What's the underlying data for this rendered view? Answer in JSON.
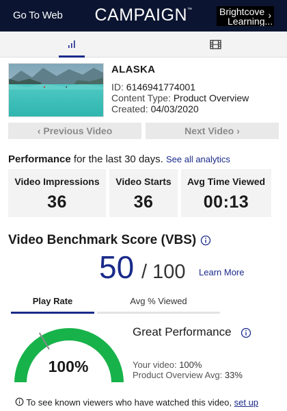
{
  "topbar": {
    "go_to_web": "Go To Web",
    "brand": "CAMPAIGN",
    "brand_tm": "™",
    "brightcove_line1": "Brightcove",
    "brightcove_line2": "Learning..."
  },
  "tabs": [
    {
      "icon": "bar-chart-icon",
      "active": true
    },
    {
      "icon": "film-icon",
      "active": false
    }
  ],
  "video": {
    "title": "ALASKA",
    "id_label": "ID:",
    "id_value": "6146941774001",
    "content_type_label": "Content Type:",
    "content_type_value": "Product Overview",
    "created_label": "Created:",
    "created_value": "04/03/2020"
  },
  "nav": {
    "prev": "Previous Video",
    "next": "Next Video"
  },
  "performance": {
    "label": "Performance",
    "period": "for the last 30 days.",
    "link": "See all analytics",
    "stats": [
      {
        "label": "Video Impressions",
        "value": "36"
      },
      {
        "label": "Video Starts",
        "value": "36"
      },
      {
        "label": "Avg Time Viewed",
        "value": "00:13"
      }
    ]
  },
  "vbs": {
    "title": "Video Benchmark Score (VBS)",
    "score": "50",
    "max": "/ 100",
    "learn_more": "Learn More",
    "tabs": [
      "Play Rate",
      "Avg % Viewed"
    ],
    "gauge_value": "100%",
    "gauge_fraction": 1.0,
    "benchmark_fraction": 0.33,
    "status": "Great Performance",
    "your_video_label": "Your video:",
    "your_video_value": "100%",
    "avg_label": "Product Overview Avg:",
    "avg_value": "33%"
  },
  "footer": {
    "text": "To see known viewers who have watched this video,",
    "link": "set up"
  },
  "colors": {
    "topbar": "#0b1531",
    "accent": "#1a2a8a",
    "gauge_green": "#17b34a"
  }
}
